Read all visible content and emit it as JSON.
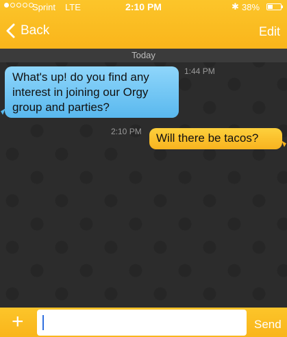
{
  "status_bar": {
    "carrier": "Sprint",
    "network": "LTE",
    "time": "2:10 PM",
    "bluetooth_icon": "bluetooth-icon",
    "battery_percent": "38%",
    "battery_level": 0.38,
    "signal_bars": 1
  },
  "nav": {
    "back_label": "Back",
    "edit_label": "Edit"
  },
  "chat": {
    "day_label": "Today",
    "messages": [
      {
        "direction": "incoming",
        "text": "What's up! do you find any interest in joining our Orgy group and parties?",
        "time": "1:44 PM"
      },
      {
        "direction": "outgoing",
        "text": "Will there be tacos?",
        "time": "2:10 PM"
      }
    ]
  },
  "composer": {
    "plus_label": "+",
    "input_value": "",
    "input_placeholder": "",
    "send_label": "Send"
  },
  "colors": {
    "accent": "#f9b51b",
    "incoming_bubble": "#6cc5f3",
    "outgoing_bubble": "#fbc22b",
    "background": "#2c2c2c"
  }
}
